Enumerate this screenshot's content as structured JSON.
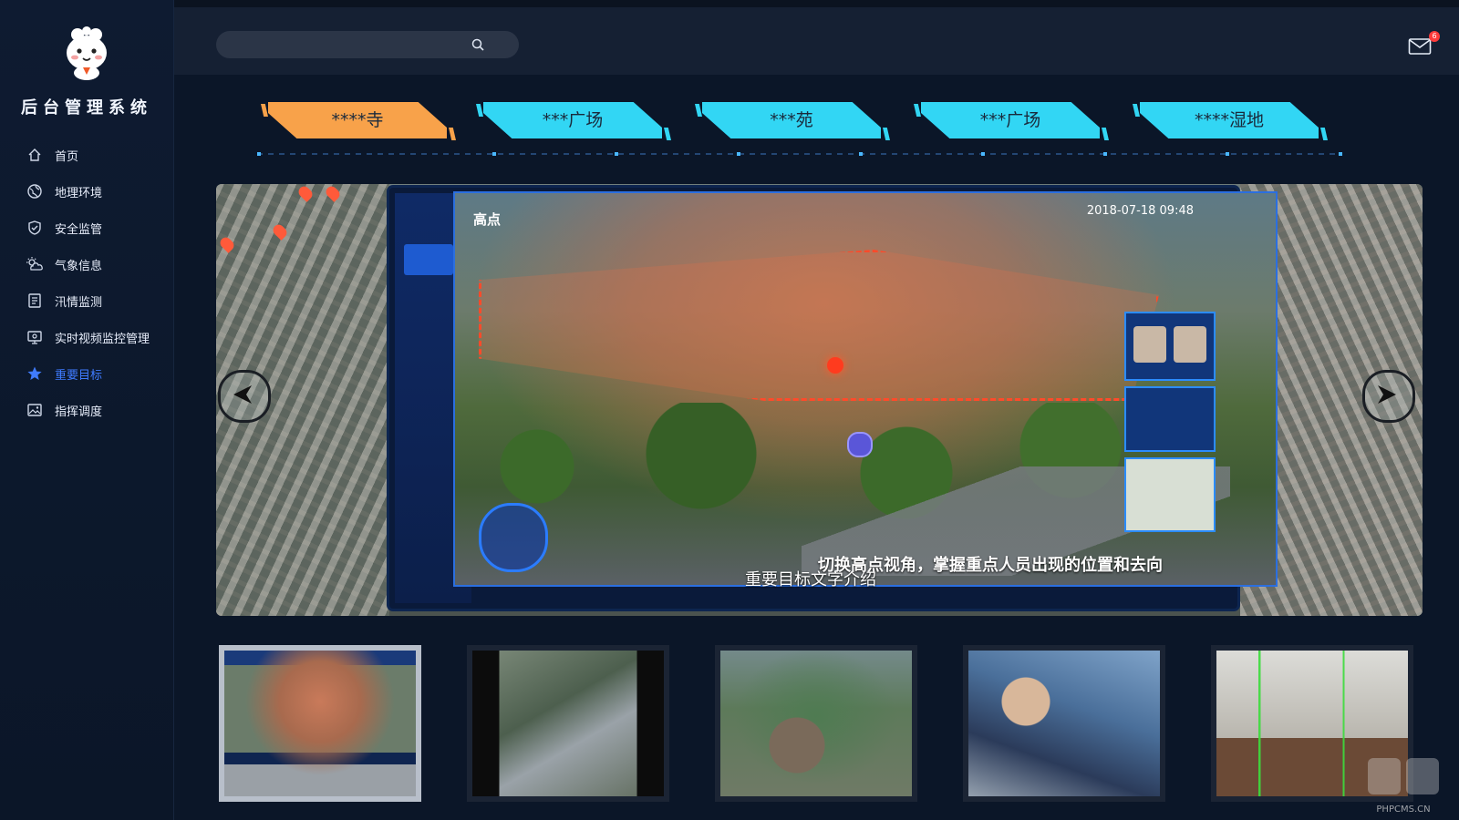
{
  "app": {
    "title": "后台管理系统"
  },
  "sidebar": {
    "items": [
      {
        "label": "首页",
        "icon": "home-icon"
      },
      {
        "label": "地理环境",
        "icon": "globe-icon"
      },
      {
        "label": "安全监管",
        "icon": "shield-icon"
      },
      {
        "label": "气象信息",
        "icon": "weather-icon"
      },
      {
        "label": "汛情监测",
        "icon": "document-icon"
      },
      {
        "label": "实时视频监控管理",
        "icon": "monitor-icon"
      },
      {
        "label": "重要目标",
        "icon": "star-icon",
        "active": true
      },
      {
        "label": "指挥调度",
        "icon": "image-icon"
      }
    ],
    "active_color": "#3f7bff"
  },
  "header": {
    "search": {
      "placeholder": "",
      "value": ""
    },
    "mail": {
      "badge": "6"
    }
  },
  "tabs": [
    {
      "label": "****寺",
      "active": true
    },
    {
      "label": "***广场",
      "active": false
    },
    {
      "label": "***苑",
      "active": false
    },
    {
      "label": "***广场",
      "active": false
    },
    {
      "label": "****湿地",
      "active": false
    }
  ],
  "colors": {
    "tab_active": "#f8a24a",
    "tab_inactive": "#32d6f4",
    "background": "#0b1628"
  },
  "viewer": {
    "scene_label": "高点",
    "timestamp": "2018-07-18 09:48",
    "caption": "切换高点视角，掌握重点人员出现的位置和去向",
    "description": "重要目标文字介绍"
  },
  "thumbnails": [
    {
      "name": "thumbnail-1",
      "active": true
    },
    {
      "name": "thumbnail-2",
      "active": false
    },
    {
      "name": "thumbnail-3",
      "active": false
    },
    {
      "name": "thumbnail-4",
      "active": false
    },
    {
      "name": "thumbnail-5",
      "active": false
    }
  ],
  "watermark": {
    "text": "PHPCMS.CN"
  }
}
